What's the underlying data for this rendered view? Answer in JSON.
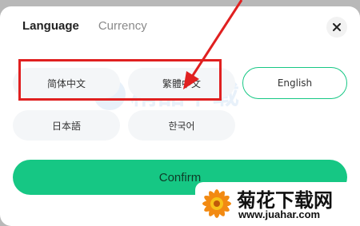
{
  "tabs": [
    {
      "label": "Language",
      "active": true
    },
    {
      "label": "Currency",
      "active": false
    }
  ],
  "languages": [
    {
      "label": "简体中文"
    },
    {
      "label": "繁體中文"
    },
    {
      "label": "English",
      "selected": true
    },
    {
      "label": "日本語"
    },
    {
      "label": "한국어"
    }
  ],
  "confirm_label": "Confirm",
  "watermark_text": "精品下载",
  "badge": {
    "title": "菊花下载网",
    "url": "www.juahar.com"
  },
  "colors": {
    "accent": "#16c784",
    "annotation": "#e02020"
  }
}
